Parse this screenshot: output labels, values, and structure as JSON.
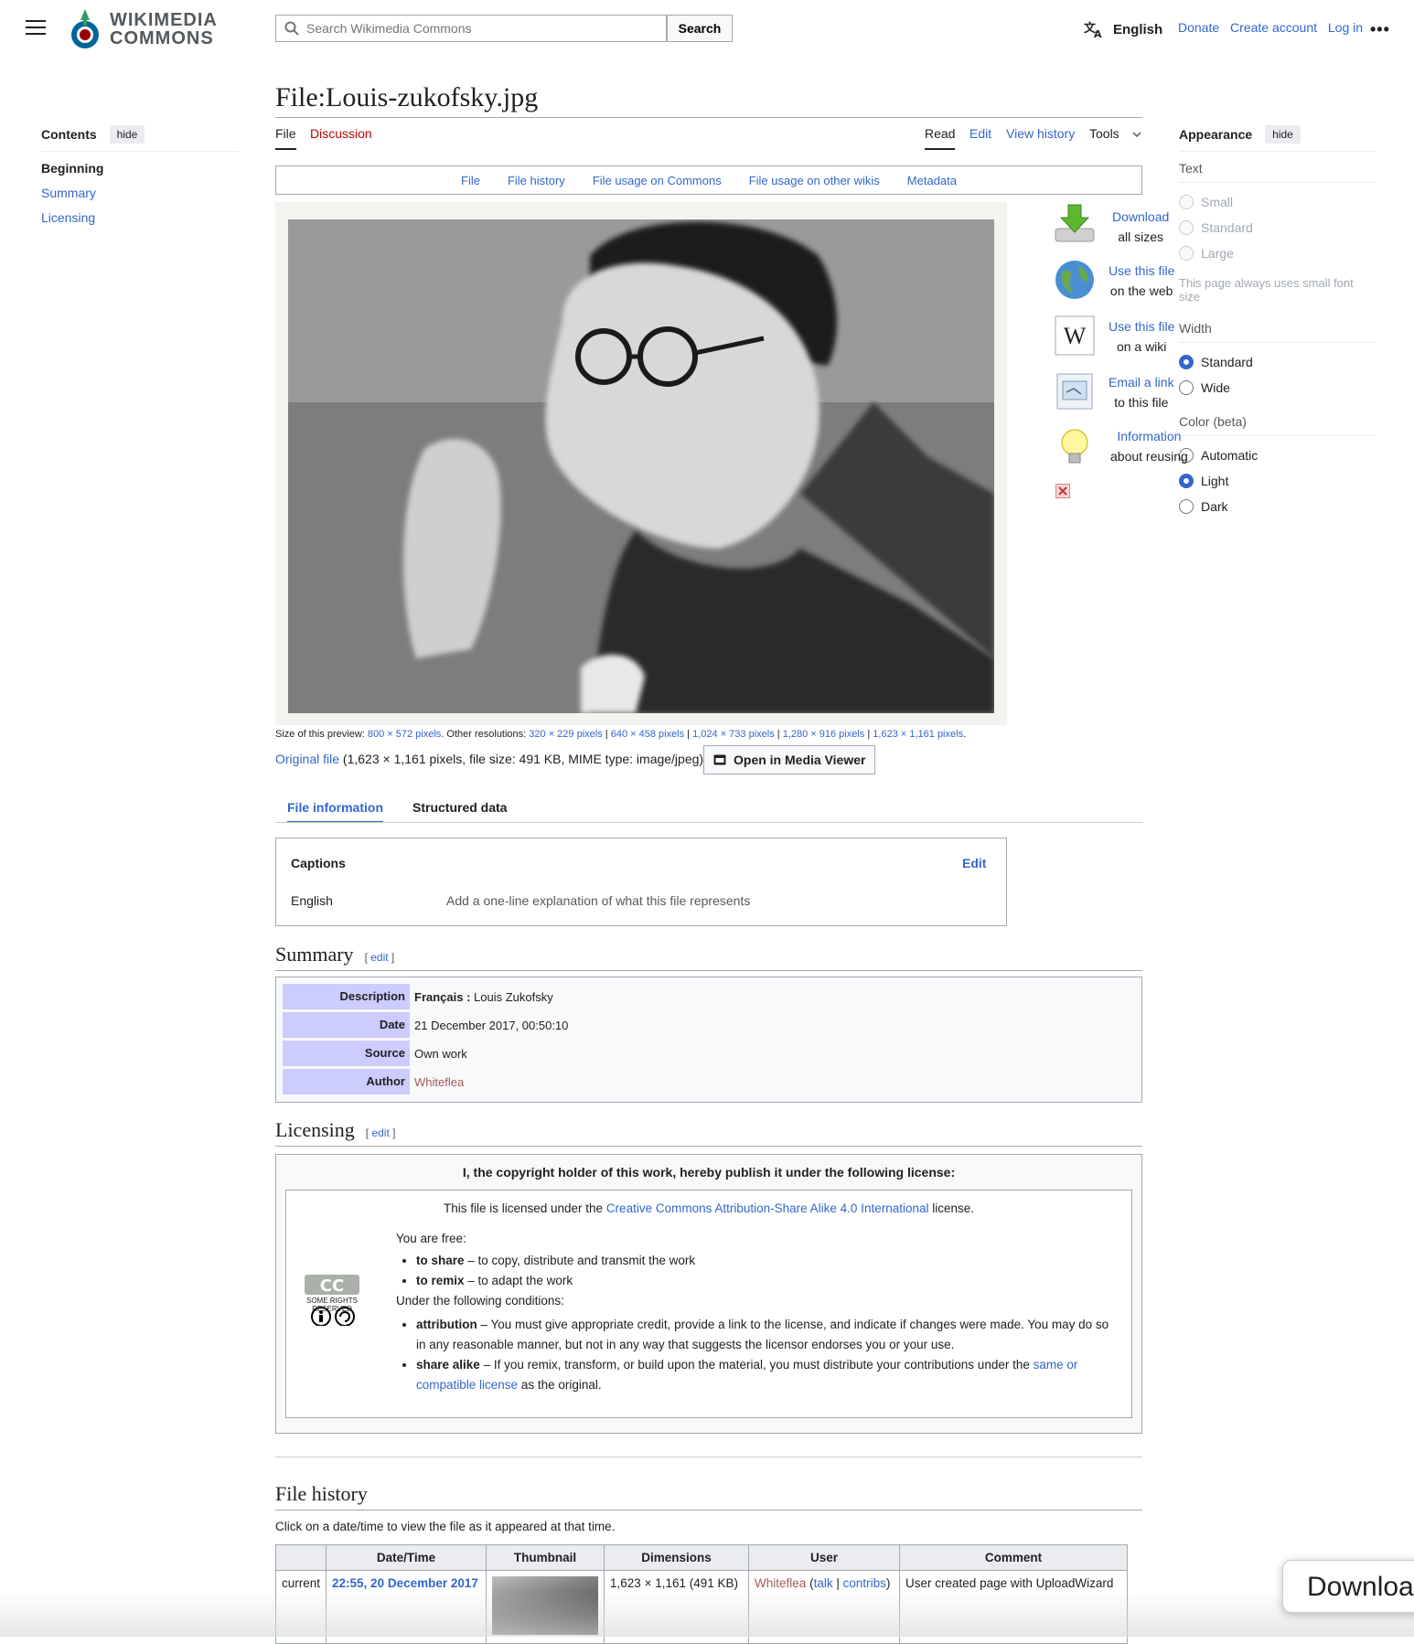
{
  "header": {
    "logo_line1": "WIKIMEDIA",
    "logo_line2": "COMMONS",
    "search_placeholder": "Search Wikimedia Commons",
    "search_button": "Search",
    "language": "English",
    "links": [
      "Donate",
      "Create account",
      "Log in"
    ]
  },
  "page": {
    "title": "File:Louis-zukofsky.jpg",
    "tabs_left": [
      "File",
      "Discussion"
    ],
    "tabs_right": [
      "Read",
      "Edit",
      "View history",
      "Tools"
    ]
  },
  "toc": {
    "heading": "Contents",
    "hide": "hide",
    "items": [
      "Beginning",
      "Summary",
      "Licensing"
    ]
  },
  "appearance": {
    "heading": "Appearance",
    "hide": "hide",
    "text_label": "Text",
    "text_options": [
      "Small",
      "Standard",
      "Large"
    ],
    "text_note": "This page always uses small font size",
    "width_label": "Width",
    "width_options": [
      "Standard",
      "Wide"
    ],
    "width_selected": "Standard",
    "color_label": "Color (beta)",
    "color_options": [
      "Automatic",
      "Light",
      "Dark"
    ],
    "color_selected": "Light"
  },
  "file_nav": [
    "File",
    "File history",
    "File usage on Commons",
    "File usage on other wikis",
    "Metadata"
  ],
  "actions": [
    {
      "link": "Download",
      "text": "all sizes",
      "icon": "download-icon"
    },
    {
      "link": "Use this file",
      "text": "on the web",
      "icon": "globe-icon"
    },
    {
      "link": "Use this file",
      "text": "on a wiki",
      "icon": "wikipedia-icon"
    },
    {
      "link": "Email a link",
      "text": "to this file",
      "icon": "email-icon"
    },
    {
      "link": "Information",
      "text": "about reusing",
      "icon": "lightbulb-icon"
    }
  ],
  "resolutions": {
    "prefix": "Size of this preview: ",
    "preview": "800 × 572 pixels",
    "other_prefix": ". Other resolutions: ",
    "others": [
      "320 × 229 pixels",
      "640 × 458 pixels",
      "1,024 × 733 pixels",
      "1,280 × 916 pixels",
      "1,623 × 1,161 pixels"
    ]
  },
  "original": {
    "link": "Original file",
    "info": " (1,623 × 1,161 pixels, file size: 491 KB, MIME type: image/jpeg)",
    "media_viewer": "Open in Media Viewer"
  },
  "info_tabs": [
    "File information",
    "Structured data"
  ],
  "captions": {
    "heading": "Captions",
    "edit": "Edit",
    "lang": "English",
    "placeholder": "Add a one-line explanation of what this file represents"
  },
  "summary": {
    "heading": "Summary",
    "edit": "edit",
    "rows": [
      {
        "key": "Description",
        "lang": "Français :",
        "value": " Louis Zukofsky"
      },
      {
        "key": "Date",
        "value": "21 December 2017, 00:50:10"
      },
      {
        "key": "Source",
        "value": "Own work"
      },
      {
        "key": "Author",
        "value": "Whiteflea"
      }
    ]
  },
  "licensing": {
    "heading": "Licensing",
    "edit": "edit",
    "banner": "I, the copyright holder of this work, hereby publish it under the following license:",
    "licensed_pre": "This file is licensed under the ",
    "license_link": "Creative Commons Attribution-Share Alike 4.0 International",
    "licensed_post": " license.",
    "free": "You are free:",
    "share_b": "to share",
    "share_t": " – to copy, distribute and transmit the work",
    "remix_b": "to remix",
    "remix_t": " – to adapt the work",
    "conditions": "Under the following conditions:",
    "attr_b": "attribution",
    "attr_t": " – You must give appropriate credit, provide a link to the license, and indicate if changes were made. You may do so in any reasonable manner, but not in any way that suggests the licensor endorses you or your use.",
    "sa_b": "share alike",
    "sa_t": " – If you remix, transform, or build upon the material, you must distribute your contributions under the ",
    "sa_link": "same or compatible license",
    "sa_end": " as the original.",
    "cc_badge": "SOME RIGHTS RESERVED"
  },
  "history": {
    "heading": "File history",
    "note": "Click on a date/time to view the file as it appeared at that time.",
    "columns": [
      "Date/Time",
      "Thumbnail",
      "Dimensions",
      "User",
      "Comment"
    ],
    "row": {
      "status": "current",
      "datetime": "22:55, 20 December 2017",
      "dimensions": "1,623 × 1,161 (491 KB)",
      "user": "Whiteflea",
      "talk": "talk",
      "contribs": "contribs",
      "comment": "User created page with UploadWizard"
    }
  },
  "floating_download": "Download"
}
